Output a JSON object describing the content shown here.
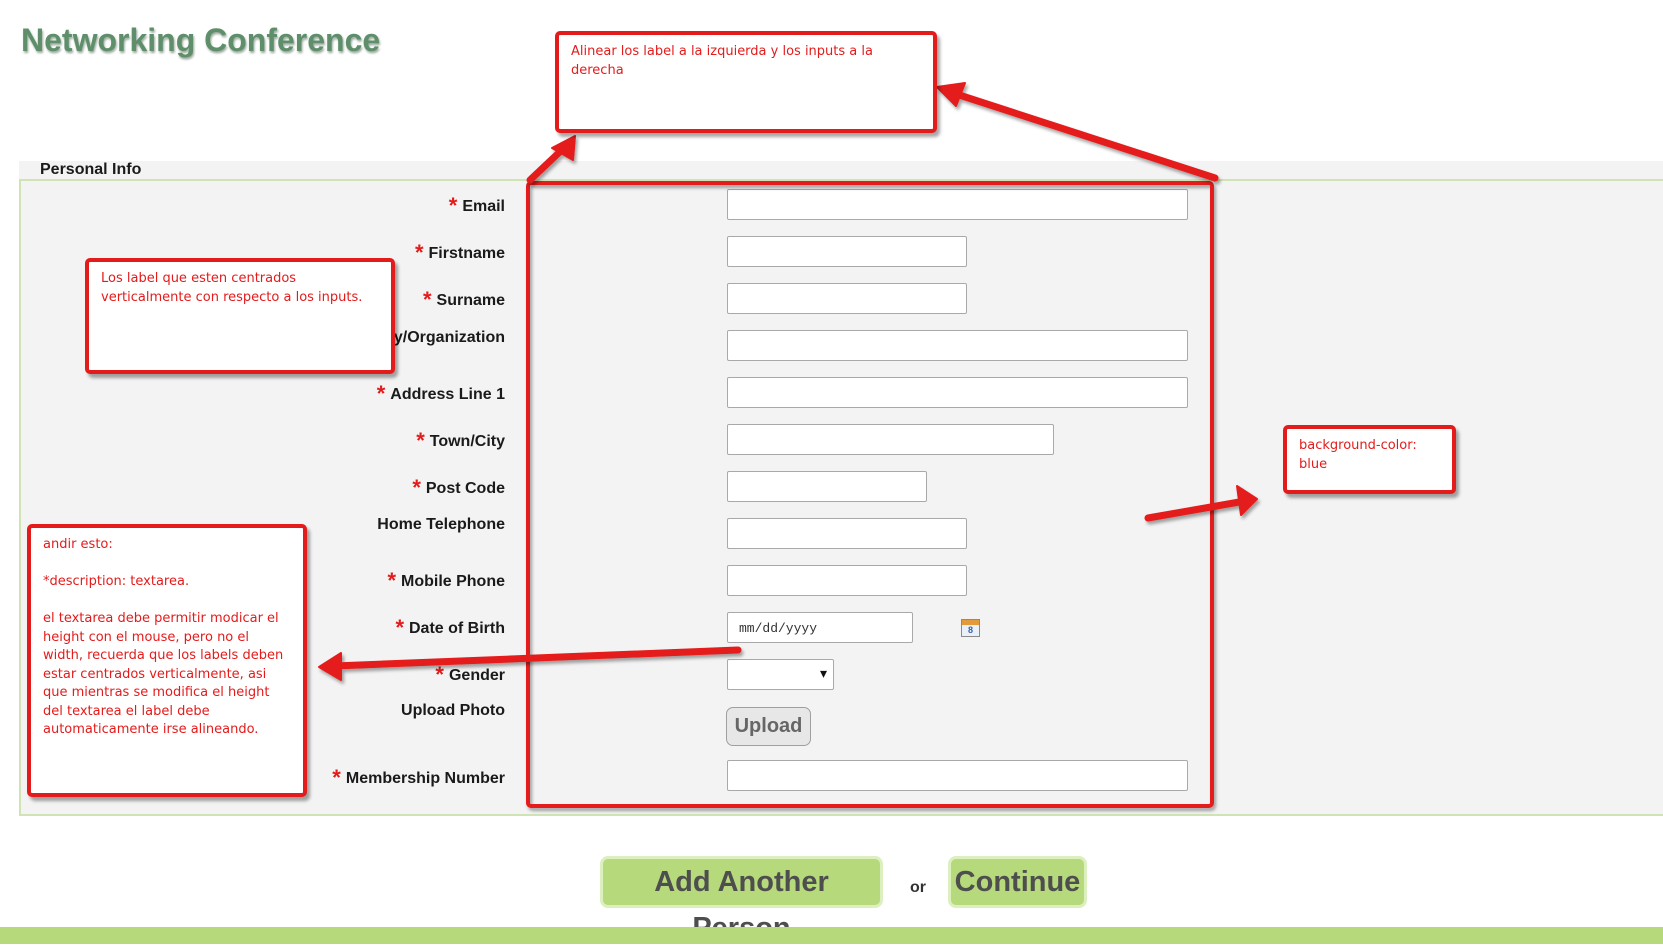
{
  "page": {
    "title": "Networking Conference",
    "legend": "Personal Info"
  },
  "form": {
    "fields": [
      {
        "label": "Email",
        "required": true
      },
      {
        "label": "Firstname",
        "required": true
      },
      {
        "label": "Surname",
        "required": true
      },
      {
        "label": "Company/Organization",
        "required": false
      },
      {
        "label": "Address Line 1",
        "required": true
      },
      {
        "label": "Town/City",
        "required": true
      },
      {
        "label": "Post Code",
        "required": true
      },
      {
        "label": "Home Telephone",
        "required": false
      },
      {
        "label": "Mobile Phone",
        "required": true
      },
      {
        "label": "Date of Birth",
        "required": true
      },
      {
        "label": "Gender",
        "required": true
      },
      {
        "label": "Upload Photo",
        "required": false
      },
      {
        "label": "Membership Number",
        "required": true
      }
    ],
    "required_marker": "*",
    "date_placeholder": "mm/dd/yyyy",
    "calendar_day": "8",
    "gender_value": "",
    "upload_label": "Upload"
  },
  "actions": {
    "add_person": "Add Another Person",
    "or": "or",
    "continue": "Continue"
  },
  "annotations": {
    "top": "Alinear los label a la izquierda y los inputs a la derecha",
    "left_top": "Los label que esten centrados verticalmente con respecto a los inputs.",
    "left_bottom": "andir esto:\n\n*description: textarea.\n\nel textarea debe permitir modicar el height con el mouse, pero no el width, recuerda que los labels deben estar centrados verticalmente, asi que mientras se modifica el height del textarea el label debe automaticamente irse alineando.",
    "right": "background-color: blue"
  },
  "colors": {
    "title": "#5e8f6a",
    "fieldset_border": "#cfe3b4",
    "fieldset_bg": "#f3f3f3",
    "button_bg": "#b5d97b",
    "required": "#e31b1b",
    "annotation": "#e41b1b"
  },
  "icons": {
    "calendar": "calendar-icon"
  }
}
